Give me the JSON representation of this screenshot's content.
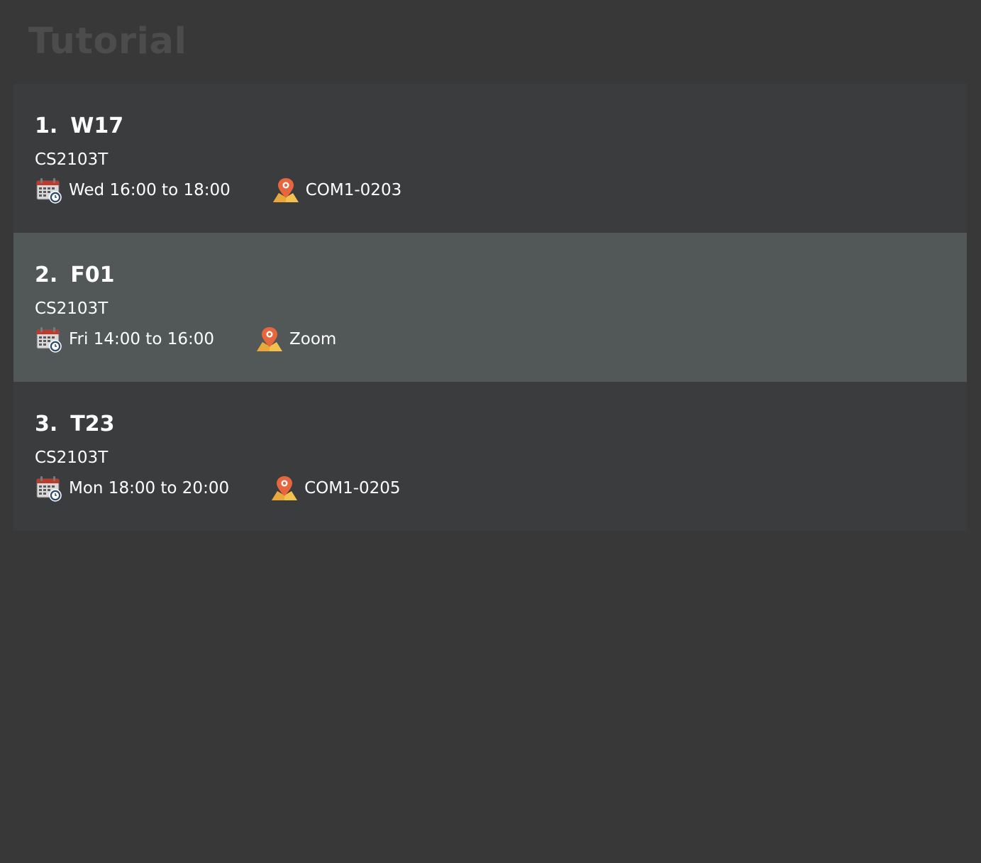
{
  "page": {
    "title": "Tutorial"
  },
  "tutorials": [
    {
      "index": "1.",
      "name": "W17",
      "module": "CS2103T",
      "time": "Wed 16:00 to 18:00",
      "venue": "COM1-0203",
      "selected": false
    },
    {
      "index": "2.",
      "name": "F01",
      "module": "CS2103T",
      "time": "Fri 14:00 to 16:00",
      "venue": "Zoom",
      "selected": true
    },
    {
      "index": "3.",
      "name": "T23",
      "module": "CS2103T",
      "time": "Mon 18:00 to 20:00",
      "venue": "COM1-0205",
      "selected": false
    }
  ],
  "icons": {
    "time": "calendar-clock-icon",
    "venue": "map-pin-icon"
  },
  "colors": {
    "background": "#383838",
    "card": "#3b3c3e",
    "card_selected": "#525758",
    "title": "#4c4c4c",
    "text": "#ffffff"
  }
}
